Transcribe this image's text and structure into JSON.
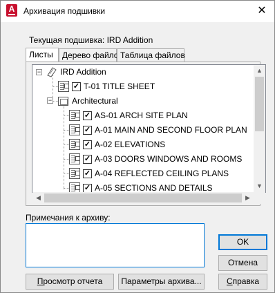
{
  "window": {
    "title": "Архивация подшивки",
    "app_icon_letter": "A",
    "close_symbol": "✕"
  },
  "current_sheet_set": {
    "label": "Текущая подшивка: IRD Addition"
  },
  "tabs": [
    {
      "label": "Листы",
      "active": true
    },
    {
      "label": "Дерево файлов",
      "active": false
    },
    {
      "label": "Таблица файлов",
      "active": false
    }
  ],
  "tree": {
    "root": {
      "label": "IRD Addition",
      "expander": "−"
    },
    "items": [
      {
        "label": "T-01 TITLE SHEET",
        "checked": true,
        "check": "✓"
      },
      {
        "label": "Architectural",
        "expander": "−",
        "is_folder": true
      },
      {
        "label": "AS-01 ARCH SITE PLAN",
        "checked": true,
        "check": "✓"
      },
      {
        "label": "A-01 MAIN AND SECOND FLOOR PLAN",
        "checked": true,
        "check": "✓"
      },
      {
        "label": "A-02 ELEVATIONS",
        "checked": true,
        "check": "✓"
      },
      {
        "label": "A-03 DOORS WINDOWS AND ROOMS",
        "checked": true,
        "check": "✓"
      },
      {
        "label": "A-04 REFLECTED CEILING PLANS",
        "checked": true,
        "check": "✓"
      },
      {
        "label": "A-05 SECTIONS AND DETAILS",
        "checked": true,
        "check": "✓"
      }
    ]
  },
  "scroll": {
    "up": "▲",
    "down": "▼",
    "left": "◀",
    "right": "▶"
  },
  "notes": {
    "label": "Примечания к архиву:",
    "value": ""
  },
  "buttons": {
    "ok": "OK",
    "cancel": "Отмена",
    "help_prefix": "",
    "help_ul": "С",
    "help_rest": "правка",
    "view_report_ul": "П",
    "view_report_rest": "росмотр отчета",
    "archive_options": "Параметры архива..."
  },
  "colors": {
    "accent": "#0078d7",
    "app_icon": "#c8102e"
  }
}
